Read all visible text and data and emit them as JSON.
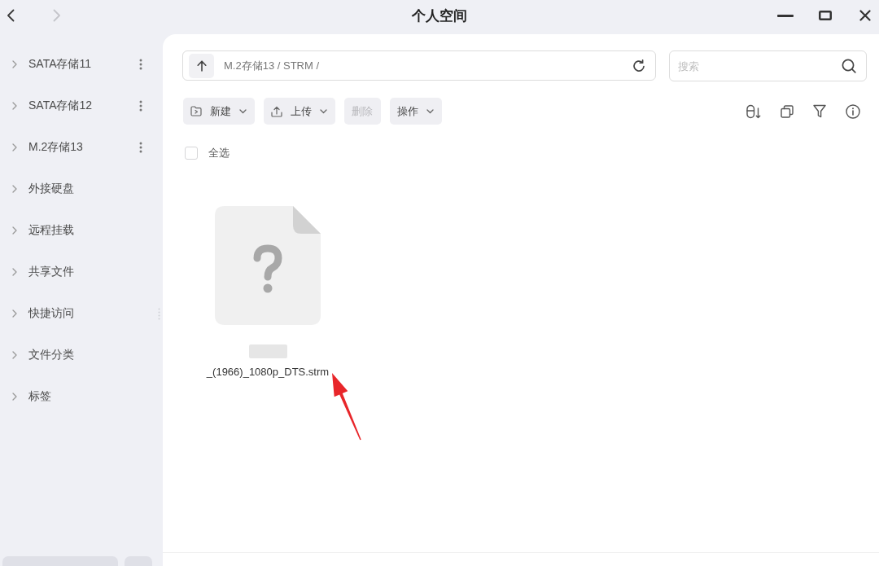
{
  "window": {
    "title": "个人空间"
  },
  "navigation": [
    {
      "kind": "back",
      "disabled": false
    },
    {
      "kind": "forward",
      "disabled": true
    }
  ],
  "sidebar": {
    "items": [
      {
        "label": "SATA存储11",
        "expanded": false,
        "has_menu": true
      },
      {
        "label": "SATA存储12",
        "expanded": false,
        "has_menu": true
      },
      {
        "label": "M.2存储13",
        "expanded": false,
        "has_menu": true
      },
      {
        "label": "外接硬盘",
        "expanded": false,
        "has_menu": false
      },
      {
        "label": "远程挂载",
        "expanded": false,
        "has_menu": false
      },
      {
        "label": "共享文件",
        "expanded": false,
        "has_menu": false
      },
      {
        "label": "快捷访问",
        "expanded": false,
        "has_menu": false
      },
      {
        "label": "文件分类",
        "expanded": false,
        "has_menu": false
      },
      {
        "label": "标签",
        "expanded": false,
        "has_menu": false
      }
    ]
  },
  "path_bar": {
    "path": "M.2存储13 / STRM /"
  },
  "search": {
    "placeholder": "搜索"
  },
  "toolbar": {
    "buttons": [
      {
        "label": "新建",
        "kind": "new",
        "dropdown": true,
        "disabled": false
      },
      {
        "label": "上传",
        "kind": "upload",
        "dropdown": true,
        "disabled": false
      },
      {
        "label": "删除",
        "kind": "delete",
        "dropdown": false,
        "disabled": true
      },
      {
        "label": "操作",
        "kind": "actions",
        "dropdown": true,
        "disabled": false
      }
    ],
    "view_tools": [
      {
        "kind": "sort"
      },
      {
        "kind": "copy"
      },
      {
        "kind": "filter"
      },
      {
        "kind": "info"
      }
    ]
  },
  "select_all": {
    "label": "全选",
    "checked": false
  },
  "files": [
    {
      "name": "_(1966)_1080p_DTS.strm",
      "kind": "unknown",
      "selected": false,
      "redacted": true
    }
  ],
  "annotations": [
    {
      "kind": "arrow"
    }
  ]
}
